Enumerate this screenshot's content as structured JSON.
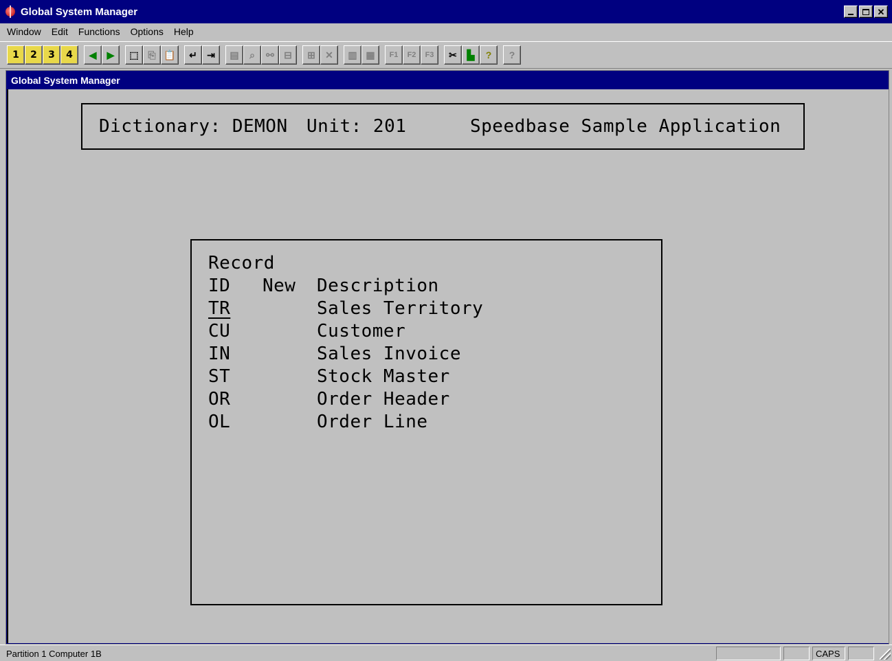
{
  "window": {
    "title": "Global System Manager",
    "document_title": "Global System Manager"
  },
  "menu": [
    "Window",
    "Edit",
    "Functions",
    "Options",
    "Help"
  ],
  "toolbar": {
    "numbers": [
      "1",
      "2",
      "3",
      "4"
    ]
  },
  "header": {
    "dictionary": "Dictionary: DEMON",
    "unit": "Unit: 201",
    "application": "Speedbase Sample Application"
  },
  "records": {
    "title": "Record",
    "columns": [
      "ID",
      "New",
      "Description"
    ],
    "rows": [
      {
        "id": "TR",
        "new": "",
        "description": "Sales Territory"
      },
      {
        "id": "CU",
        "new": "",
        "description": "Customer"
      },
      {
        "id": "IN",
        "new": "",
        "description": "Sales Invoice"
      },
      {
        "id": "ST",
        "new": "",
        "description": "Stock Master"
      },
      {
        "id": "OR",
        "new": "",
        "description": "Order Header"
      },
      {
        "id": "OL",
        "new": "",
        "description": "Order Line"
      }
    ]
  },
  "status": {
    "left": "Partition 1 Computer 1B",
    "caps": "CAPS"
  }
}
